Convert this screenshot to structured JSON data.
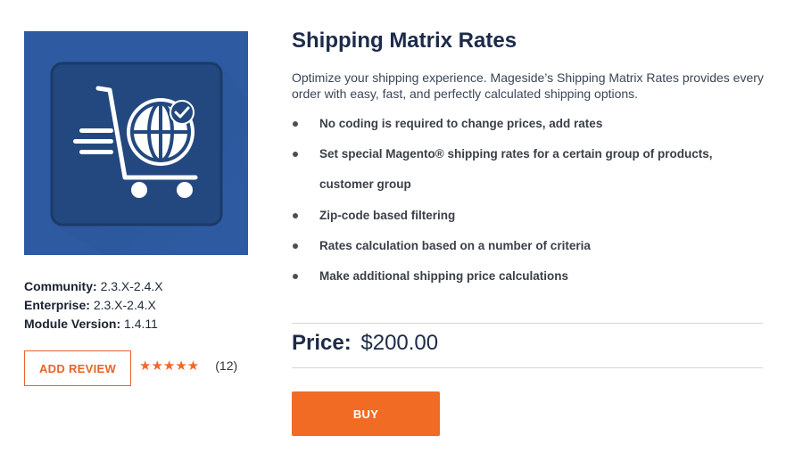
{
  "product": {
    "title": "Shipping Matrix Rates",
    "description": "Optimize your shipping experience. Mageside’s Shipping Matrix Rates provides every order with easy, fast, and perfectly calculated shipping options.",
    "image_icon": "shopping-cart-globe-icon",
    "features": [
      "No coding is required to change prices, add rates",
      "Set special Magento® shipping rates for a certain group of products,",
      "customer group",
      "Zip-code based filtering",
      "Rates calculation based on a number of criteria",
      "Make additional shipping price calculations"
    ]
  },
  "specs": {
    "community_label": "Community:",
    "community_value": "2.3.X-2.4.X",
    "enterprise_label": "Enterprise:",
    "enterprise_value": "2.3.X-2.4.X",
    "version_label": "Module Version:",
    "version_value": "1.4.11"
  },
  "reviews": {
    "add_label": "ADD REVIEW",
    "stars": "★★★★★",
    "rating": 5,
    "count": "(12)"
  },
  "price": {
    "label": "Price:",
    "value": "$200.00"
  },
  "buy": {
    "label": "BUY"
  },
  "colors": {
    "accent": "#f26b24",
    "tile_background": "#2d5aa0",
    "title": "#1d2b4a"
  }
}
